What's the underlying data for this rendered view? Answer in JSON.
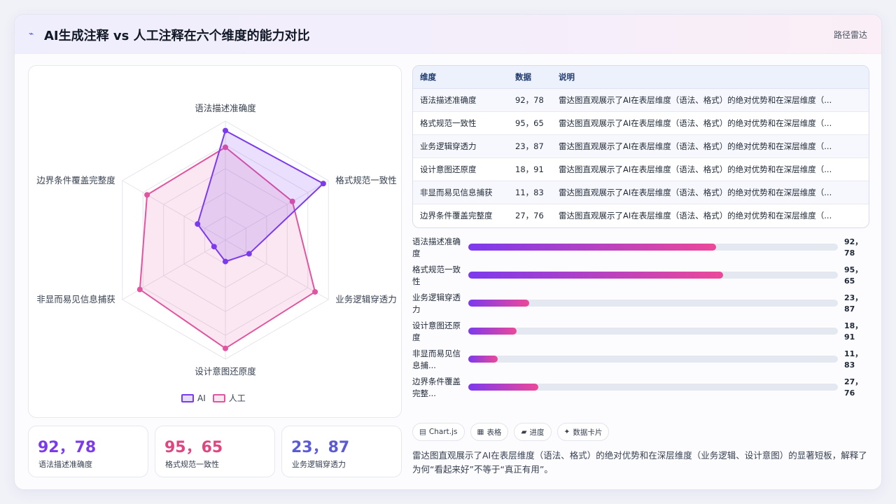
{
  "header": {
    "icon": "trend-icon",
    "title": "AI生成注释 vs 人工注释在六个维度的能力对比",
    "link": "路径雷达"
  },
  "colors": {
    "ai": "#7c3aed",
    "human": "#e0559f",
    "accent_pink": "#e0457f",
    "accent_indigo": "#5b5bd6"
  },
  "chart_data": {
    "type": "radar",
    "axes": [
      "语法描述准确度",
      "格式规范一致性",
      "业务逻辑穿透力",
      "设计意图还原度",
      "非显而易见信息捕获",
      "边界条件覆盖完整度"
    ],
    "range": [
      0,
      100
    ],
    "series": [
      {
        "name": "AI",
        "values": [
          92,
          95,
          23,
          18,
          11,
          27
        ]
      },
      {
        "name": "人工",
        "values": [
          78,
          65,
          87,
          91,
          83,
          76
        ]
      }
    ],
    "legend": [
      "AI",
      "人工"
    ]
  },
  "stats": [
    {
      "value": "92，78",
      "label": "语法描述准确度"
    },
    {
      "value": "95，65",
      "label": "格式规范一致性"
    },
    {
      "value": "23，87",
      "label": "业务逻辑穿透力"
    }
  ],
  "table": {
    "headers": [
      "维度",
      "数据",
      "说明"
    ],
    "rows": [
      [
        "语法描述准确度",
        "92，78",
        "雷达图直观展示了AI在表层维度（语法、格式）的绝对优势和在深层维度（..."
      ],
      [
        "格式规范一致性",
        "95，65",
        "雷达图直观展示了AI在表层维度（语法、格式）的绝对优势和在深层维度（..."
      ],
      [
        "业务逻辑穿透力",
        "23，87",
        "雷达图直观展示了AI在表层维度（语法、格式）的绝对优势和在深层维度（..."
      ],
      [
        "设计意图还原度",
        "18，91",
        "雷达图直观展示了AI在表层维度（语法、格式）的绝对优势和在深层维度（..."
      ],
      [
        "非显而易见信息捕获",
        "11，83",
        "雷达图直观展示了AI在表层维度（语法、格式）的绝对优势和在深层维度（..."
      ],
      [
        "边界条件覆盖完整度",
        "27，76",
        "雷达图直观展示了AI在表层维度（语法、格式）的绝对优势和在深层维度（..."
      ]
    ]
  },
  "bars": [
    {
      "label": "语法描述准确度",
      "value": "92，78",
      "level": 0.67
    },
    {
      "label": "格式规范一致性",
      "value": "95，65",
      "level": 0.69
    },
    {
      "label": "业务逻辑穿透力",
      "value": "23，87",
      "level": 0.165
    },
    {
      "label": "设计意图还原度",
      "value": "18，91",
      "level": 0.13
    },
    {
      "label": "非显而易见信息捕...",
      "value": "11，83",
      "level": 0.08
    },
    {
      "label": "边界条件覆盖完整...",
      "value": "27，76",
      "level": 0.19
    }
  ],
  "chips": [
    {
      "icon": "chart-icon",
      "glyph": "▤",
      "label": "Chart.js"
    },
    {
      "icon": "table-icon",
      "glyph": "▦",
      "label": "表格"
    },
    {
      "icon": "progress-icon",
      "glyph": "▰",
      "label": "进度"
    },
    {
      "icon": "card-icon",
      "glyph": "✦",
      "label": "数据卡片"
    }
  ],
  "note": "雷达图直观展示了AI在表层维度（语法、格式）的绝对优势和在深层维度（业务逻辑、设计意图）的显著短板，解释了为何“看起来好”不等于“真正有用”。"
}
